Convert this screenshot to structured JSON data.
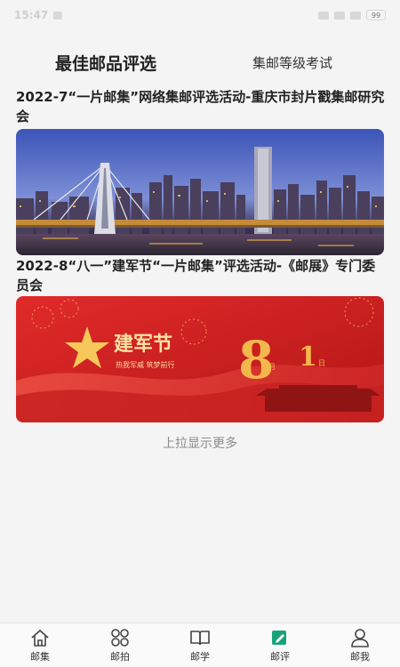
{
  "status_bar": {
    "time": "15:47",
    "battery": "99"
  },
  "tabs": {
    "active": "最佳邮品评选",
    "inactive": "集邮等级考试"
  },
  "cards": [
    {
      "title": "2022-7“一片邮集”网络集邮评选活动-重庆市封片戳集邮研究会",
      "image": "chongqing-night-skyline-bridge"
    },
    {
      "title": "2022-8“八一”建军节“一片邮集”评选活动-《邮展》专门委员会",
      "image": "army-day-red-banner",
      "banner_text": {
        "main": "建军节",
        "sub": "热我军威 筑梦前行",
        "month": "8",
        "month_unit": "月",
        "day": "1",
        "day_unit": "日"
      }
    }
  ],
  "load_more": "上拉显示更多",
  "nav": [
    {
      "label": "邮集",
      "icon": "home-icon"
    },
    {
      "label": "邮拍",
      "icon": "grid-icon"
    },
    {
      "label": "邮学",
      "icon": "book-icon"
    },
    {
      "label": "邮评",
      "icon": "edit-icon",
      "active": true
    },
    {
      "label": "邮我",
      "icon": "user-icon"
    }
  ],
  "colors": {
    "accent": "#1aa37a",
    "banner_red": "#d31f1f",
    "gold": "#f6c85a"
  }
}
